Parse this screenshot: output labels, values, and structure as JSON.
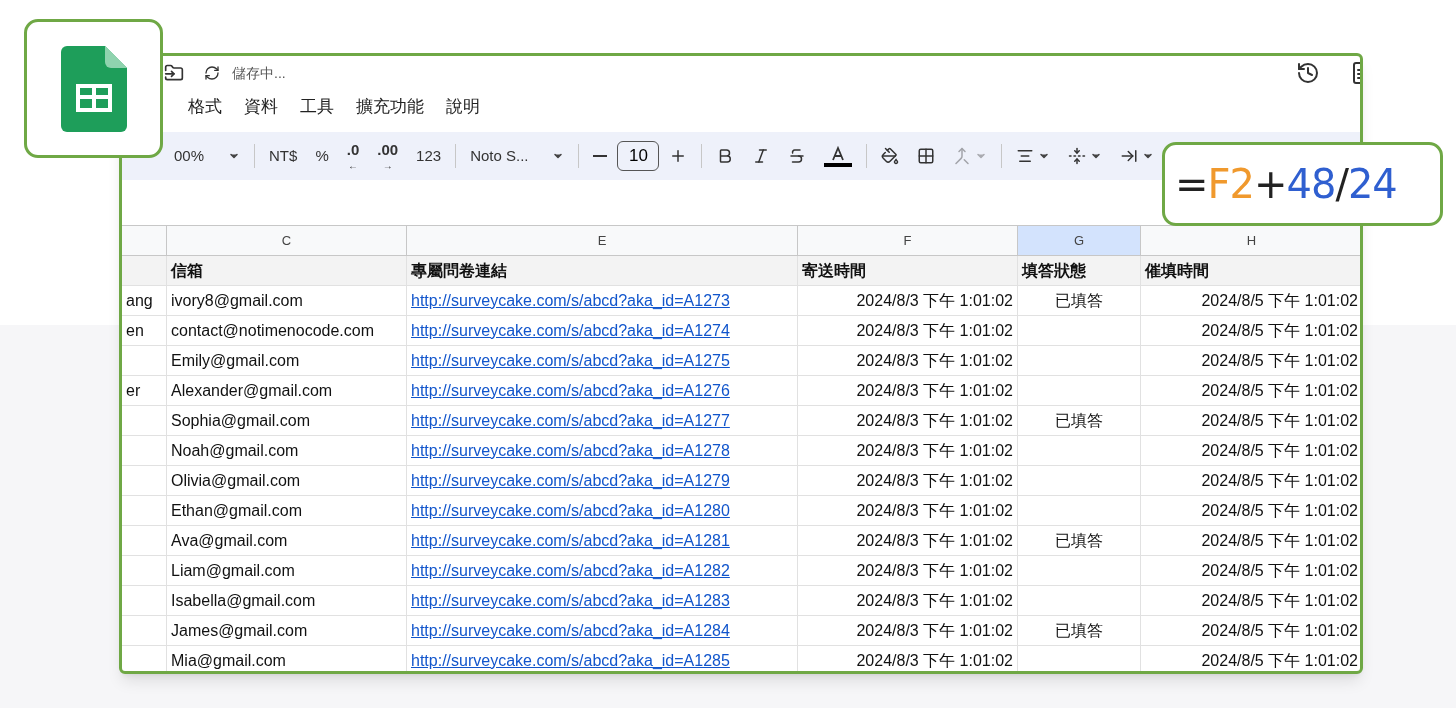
{
  "title_bar": {
    "status": "儲存中..."
  },
  "menu": [
    "格式",
    "資料",
    "工具",
    "擴充功能",
    "說明"
  ],
  "toolbar": [
    {
      "kind": "dropdown",
      "label": "00%"
    },
    {
      "kind": "separator"
    },
    {
      "kind": "text",
      "label": "NT$"
    },
    {
      "kind": "text",
      "label": "%"
    },
    {
      "kind": "decimal-less",
      "label": ".0",
      "arrow": "←"
    },
    {
      "kind": "decimal-more",
      "label": ".00",
      "arrow": "→"
    },
    {
      "kind": "text",
      "label": "123"
    },
    {
      "kind": "separator"
    },
    {
      "kind": "dropdown",
      "label": "Noto S..."
    },
    {
      "kind": "separator"
    },
    {
      "kind": "minus"
    },
    {
      "kind": "size",
      "label": "10"
    },
    {
      "kind": "plus"
    },
    {
      "kind": "separator"
    },
    {
      "kind": "bold"
    },
    {
      "kind": "italic"
    },
    {
      "kind": "strike"
    },
    {
      "kind": "text-color"
    },
    {
      "kind": "separator"
    },
    {
      "kind": "fill"
    },
    {
      "kind": "borders"
    },
    {
      "kind": "merge",
      "disabled": true
    },
    {
      "kind": "separator"
    },
    {
      "kind": "align"
    },
    {
      "kind": "valign"
    },
    {
      "kind": "wrap"
    }
  ],
  "table": {
    "columns": [
      {
        "selected": false
      },
      {
        "label": "C",
        "selected": false
      },
      {
        "label": "E",
        "selected": false
      },
      {
        "label": "F",
        "selected": false
      },
      {
        "label": "G",
        "selected": true
      },
      {
        "label": "H",
        "selected": false
      }
    ],
    "header_row": [
      "信箱",
      "專屬問卷連結",
      "寄送時間",
      "填答狀態",
      "催填時間"
    ],
    "rows": [
      {
        "column_1": "ang",
        "email": "ivory8@gmail.com",
        "link": "http://surveycake.com/s/abcd?aka_id=A1273",
        "sent": "2024/8/3 下午 1:01:02",
        "status": "已填答",
        "remind": "2024/8/5 下午 1:01:02"
      },
      {
        "column_1": "en",
        "email": "contact@notimenocode.com",
        "link": "http://surveycake.com/s/abcd?aka_id=A1274",
        "sent": "2024/8/3 下午 1:01:02",
        "remind": "2024/8/5 下午 1:01:02"
      },
      {
        "email": "Emily@gmail.com",
        "link": "http://surveycake.com/s/abcd?aka_id=A1275",
        "sent": "2024/8/3 下午 1:01:02",
        "remind": "2024/8/5 下午 1:01:02"
      },
      {
        "column_1": "er",
        "email": "Alexander@gmail.com",
        "link": "http://surveycake.com/s/abcd?aka_id=A1276",
        "sent": "2024/8/3 下午 1:01:02",
        "remind": "2024/8/5 下午 1:01:02"
      },
      {
        "email": "Sophia@gmail.com",
        "link": "http://surveycake.com/s/abcd?aka_id=A1277",
        "sent": "2024/8/3 下午 1:01:02",
        "status": "已填答",
        "remind": "2024/8/5 下午 1:01:02"
      },
      {
        "email": "Noah@gmail.com",
        "link": "http://surveycake.com/s/abcd?aka_id=A1278",
        "sent": "2024/8/3 下午 1:01:02",
        "remind": "2024/8/5 下午 1:01:02"
      },
      {
        "email": "Olivia@gmail.com",
        "link": "http://surveycake.com/s/abcd?aka_id=A1279",
        "sent": "2024/8/3 下午 1:01:02",
        "remind": "2024/8/5 下午 1:01:02"
      },
      {
        "email": "Ethan@gmail.com",
        "link": "http://surveycake.com/s/abcd?aka_id=A1280",
        "sent": "2024/8/3 下午 1:01:02",
        "remind": "2024/8/5 下午 1:01:02"
      },
      {
        "email": "Ava@gmail.com",
        "link": "http://surveycake.com/s/abcd?aka_id=A1281",
        "sent": "2024/8/3 下午 1:01:02",
        "status": "已填答",
        "remind": "2024/8/5 下午 1:01:02"
      },
      {
        "email": "Liam@gmail.com",
        "link": "http://surveycake.com/s/abcd?aka_id=A1282",
        "sent": "2024/8/3 下午 1:01:02",
        "remind": "2024/8/5 下午 1:01:02"
      },
      {
        "email": "Isabella@gmail.com",
        "link": "http://surveycake.com/s/abcd?aka_id=A1283",
        "sent": "2024/8/3 下午 1:01:02",
        "remind": "2024/8/5 下午 1:01:02"
      },
      {
        "email": "James@gmail.com",
        "link": "http://surveycake.com/s/abcd?aka_id=A1284",
        "sent": "2024/8/3 下午 1:01:02",
        "status": "已填答",
        "remind": "2024/8/5 下午 1:01:02"
      },
      {
        "email": "Mia@gmail.com",
        "link": "http://surveycake.com/s/abcd?aka_id=A1285",
        "sent": "2024/8/3 下午 1:01:02",
        "remind": "2024/8/5 下午 1:01:02"
      }
    ]
  },
  "formula_callout": {
    "tokens": [
      {
        "text": "=",
        "color": "#222222"
      },
      {
        "text": "F2",
        "color": "#f0992d"
      },
      {
        "text": "+",
        "color": "#222222"
      },
      {
        "text": "48",
        "color": "#2f5fd0"
      },
      {
        "text": "/",
        "color": "#222222"
      },
      {
        "text": "24",
        "color": "#2f5fd0"
      }
    ]
  }
}
